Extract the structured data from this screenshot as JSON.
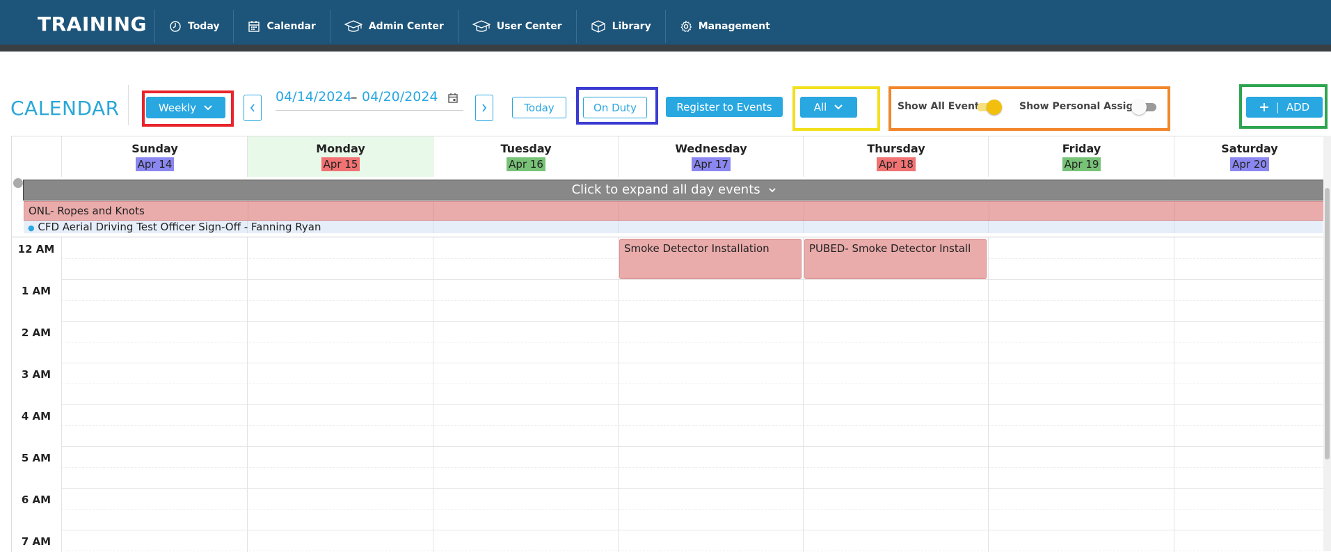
{
  "app": {
    "title": "TRAINING",
    "nav": [
      {
        "label": "Today",
        "icon": "clock-icon"
      },
      {
        "label": "Calendar",
        "icon": "calendar-icon"
      },
      {
        "label": "Admin Center",
        "icon": "graduation-cap-icon"
      },
      {
        "label": "User Center",
        "icon": "graduation-cap-icon"
      },
      {
        "label": "Library",
        "icon": "box-icon"
      },
      {
        "label": "Management",
        "icon": "gear-icon"
      }
    ]
  },
  "toolbar": {
    "title": "CALENDAR",
    "view_label": "Weekly",
    "start_date": "04/14/2024",
    "date_separator": "–",
    "end_date": "04/20/2024",
    "today_label": "Today",
    "on_duty_label": "On Duty",
    "register_label": "Register to Events",
    "filter_label": "All",
    "show_all_events_label": "Show All Events",
    "show_all_events_on": true,
    "show_personal_label": "Show Personal Assigns.",
    "show_personal_on": false,
    "add_label": "ADD",
    "highlight_colors": {
      "view": "#e8242c",
      "on_duty": "#3b3bd1",
      "filter": "#f2e01c",
      "toggles": "#f2862b",
      "add": "#2ea44f"
    }
  },
  "calendar": {
    "days": [
      {
        "name": "Sunday",
        "date": "Apr 14",
        "chip_color": "#8b87f0"
      },
      {
        "name": "Monday",
        "date": "Apr 15",
        "chip_color": "#f07272"
      },
      {
        "name": "Tuesday",
        "date": "Apr 16",
        "chip_color": "#78c278"
      },
      {
        "name": "Wednesday",
        "date": "Apr 17",
        "chip_color": "#8b87f0"
      },
      {
        "name": "Thursday",
        "date": "Apr 18",
        "chip_color": "#f07272"
      },
      {
        "name": "Friday",
        "date": "Apr 19",
        "chip_color": "#78c278"
      },
      {
        "name": "Saturday",
        "date": "Apr 20",
        "chip_color": "#8b87f0"
      }
    ],
    "today_index": 1,
    "today_color": "#e9f9e9",
    "expand_label": "Click to expand all day events",
    "all_day_events": [
      {
        "title": "ONL- Ropes and Knots"
      },
      {
        "title": "CFD Aerial Driving Test Officer Sign-Off - Fanning Ryan"
      }
    ],
    "hours": [
      "12 AM",
      "1 AM",
      "2 AM",
      "3 AM",
      "4 AM",
      "5 AM",
      "6 AM",
      "7 AM"
    ],
    "events": [
      {
        "title": "Smoke Detector Installation",
        "day": "Wednesday"
      },
      {
        "title": "PUBED- Smoke Detector Install",
        "day": "Thursday"
      }
    ]
  }
}
